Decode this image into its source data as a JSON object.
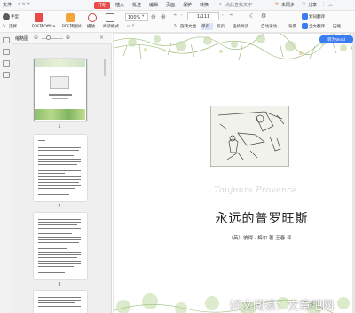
{
  "menubar": {
    "file": "文件",
    "items": [
      "开始",
      "插入",
      "批注",
      "编辑",
      "页面",
      "保护",
      "转换"
    ],
    "active_index": 0,
    "search_placeholder": "点此查找文字",
    "sync": "未同步",
    "share": "分享"
  },
  "toolbar": {
    "hand": "手型",
    "select": "选择",
    "pdf_to_office": "PDF转Office",
    "pdf_to_image": "PDF转图片",
    "play": "播放",
    "read_mode": "阅读模式",
    "zoom": "100%",
    "page_current": "1",
    "page_total": "/111",
    "rotate": "旋转文档",
    "single_page": "单页",
    "double_page": "双页",
    "continuous": "连续阅读",
    "auto_scroll": "自动滚动",
    "background": "背景",
    "translate_select": "划词翻译",
    "translate_full": "全文翻译",
    "compress": "压缩"
  },
  "thumbnails": {
    "header": "缩略图",
    "pages": [
      {
        "num": "1"
      },
      {
        "num": "2"
      },
      {
        "num": "3"
      }
    ]
  },
  "document": {
    "to_word": "转为Word",
    "script_title": "Toujours Provence",
    "title": "永远的普罗旺斯",
    "author": "（英）彼得 · 梅尔  著    王春  译"
  },
  "watermark": "好文阅读：文章吧网",
  "colors": {
    "accent": "#e84949",
    "blue": "#3b7cf2"
  }
}
